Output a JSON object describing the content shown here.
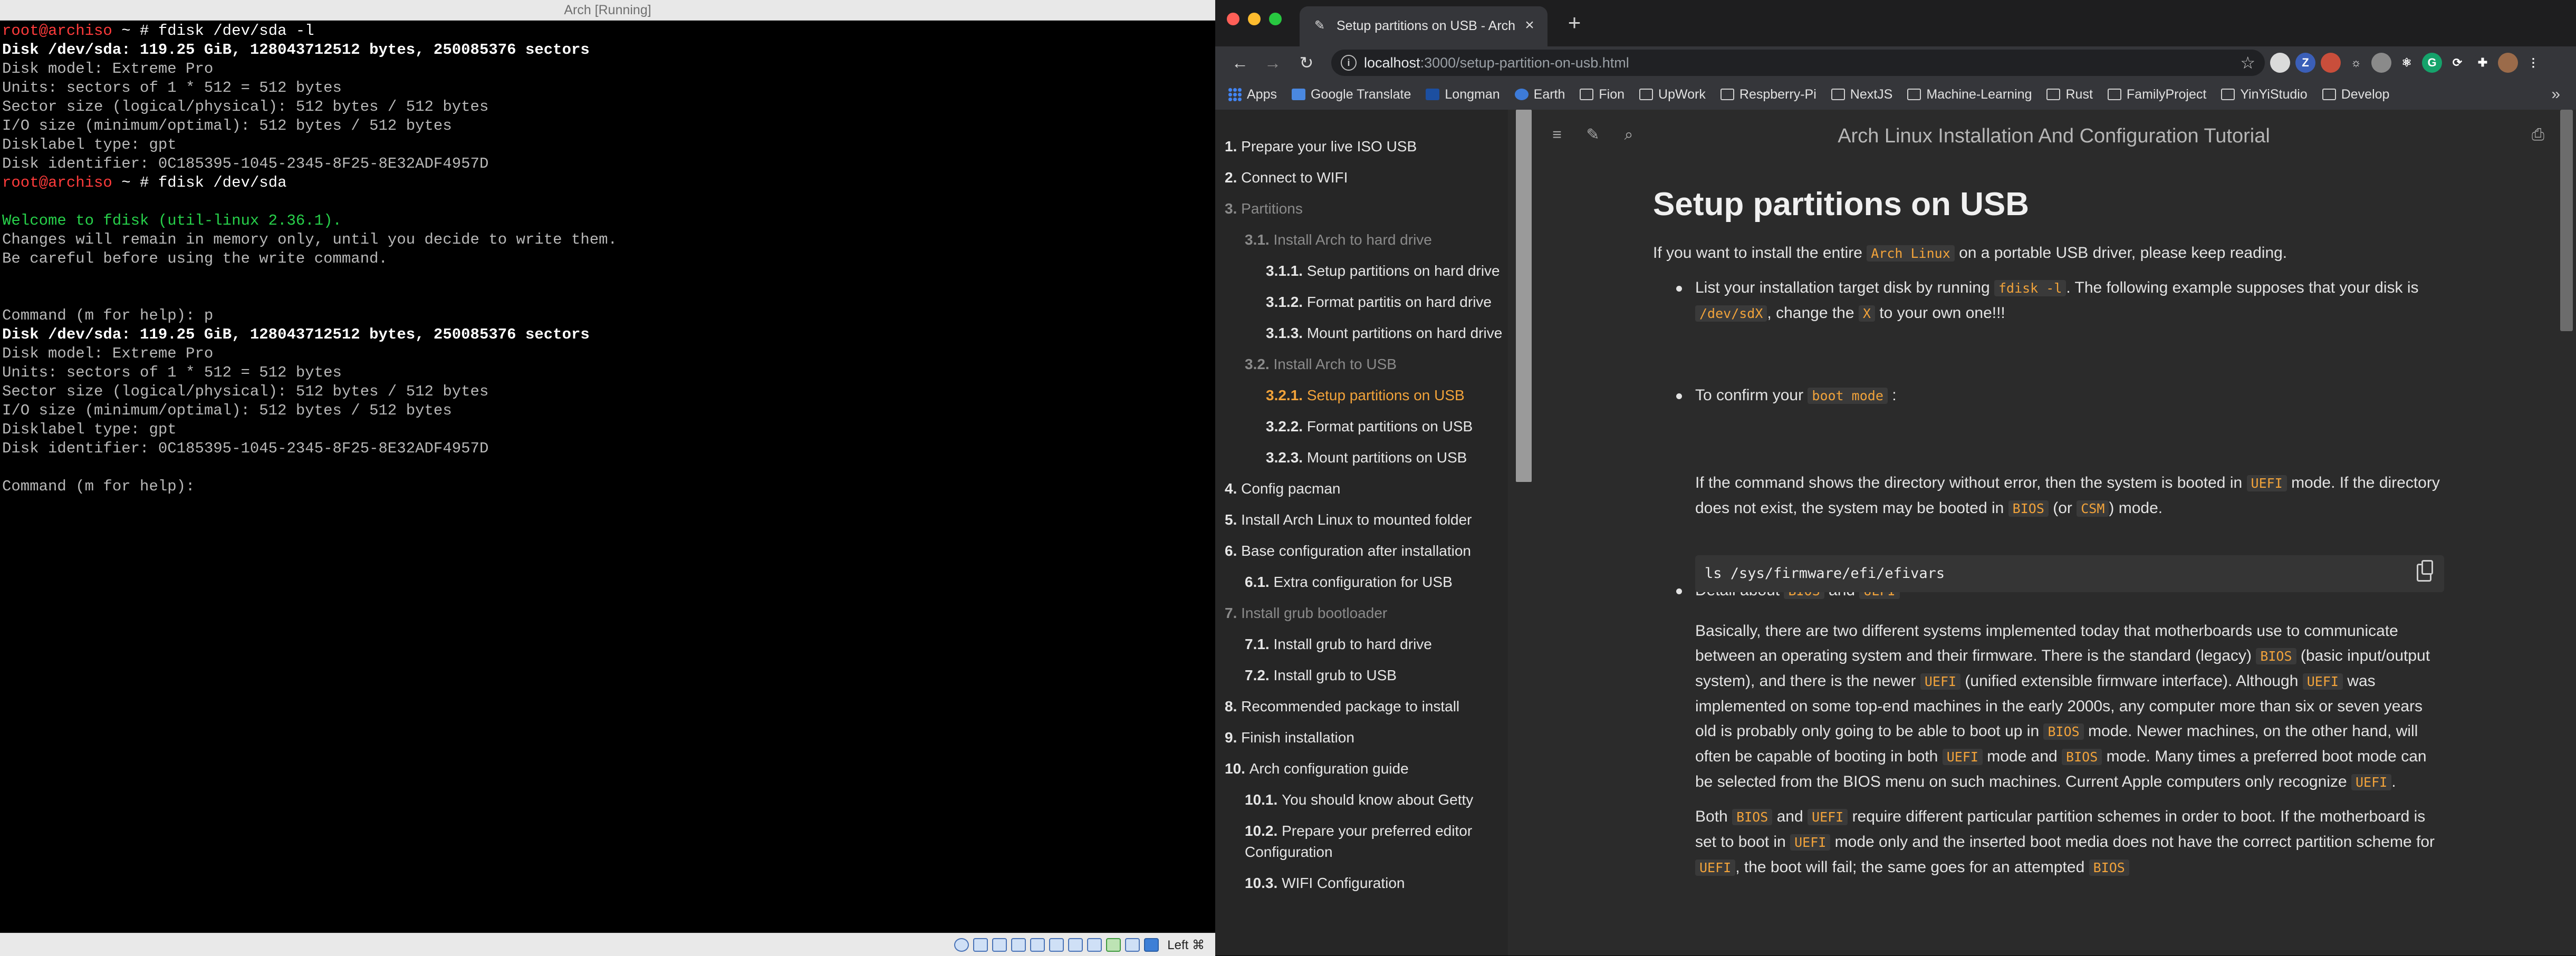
{
  "vm": {
    "title": "Arch [Running]",
    "host_key": "Left ⌘",
    "terminal_lines": [
      {
        "text": "root@archiso ~ # fdisk /dev/sda -l",
        "style": "prompt"
      },
      {
        "text": "Disk /dev/sda: 119.25 GiB, 128043712512 bytes, 250085376 sectors",
        "style": "bold"
      },
      {
        "text": "Disk model: Extreme Pro",
        "style": "normal"
      },
      {
        "text": "Units: sectors of 1 * 512 = 512 bytes",
        "style": "normal"
      },
      {
        "text": "Sector size (logical/physical): 512 bytes / 512 bytes",
        "style": "normal"
      },
      {
        "text": "I/O size (minimum/optimal): 512 bytes / 512 bytes",
        "style": "normal"
      },
      {
        "text": "Disklabel type: gpt",
        "style": "normal"
      },
      {
        "text": "Disk identifier: 0C185395-1045-2345-8F25-8E32ADF4957D",
        "style": "normal"
      },
      {
        "text": "root@archiso ~ # fdisk /dev/sda",
        "style": "prompt"
      },
      {
        "text": "",
        "style": "normal"
      },
      {
        "text": "Welcome to fdisk (util-linux 2.36.1).",
        "style": "green"
      },
      {
        "text": "Changes will remain in memory only, until you decide to write them.",
        "style": "normal"
      },
      {
        "text": "Be careful before using the write command.",
        "style": "normal"
      },
      {
        "text": "",
        "style": "normal"
      },
      {
        "text": "",
        "style": "normal"
      },
      {
        "text": "Command (m for help): p",
        "style": "normal"
      },
      {
        "text": "Disk /dev/sda: 119.25 GiB, 128043712512 bytes, 250085376 sectors",
        "style": "bold"
      },
      {
        "text": "Disk model: Extreme Pro",
        "style": "normal"
      },
      {
        "text": "Units: sectors of 1 * 512 = 512 bytes",
        "style": "normal"
      },
      {
        "text": "Sector size (logical/physical): 512 bytes / 512 bytes",
        "style": "normal"
      },
      {
        "text": "I/O size (minimum/optimal): 512 bytes / 512 bytes",
        "style": "normal"
      },
      {
        "text": "Disklabel type: gpt",
        "style": "normal"
      },
      {
        "text": "Disk identifier: 0C185395-1045-2345-8F25-8E32ADF4957D",
        "style": "normal"
      },
      {
        "text": "",
        "style": "normal"
      },
      {
        "text": "Command (m for help):",
        "style": "normal"
      }
    ],
    "status_icons": [
      "hard-disk-icon",
      "optical-drive-icon",
      "audio-icon",
      "network-icon",
      "usb-icon",
      "shared-folder-icon",
      "display-icon",
      "video-capture-icon",
      "cpu-icon",
      "mouse-integration-icon",
      "arrow-down-icon"
    ]
  },
  "browser": {
    "tab_title": "Setup partitions on USB - Arch Linux",
    "new_tab": "+",
    "url_host": "localhost",
    "url_rest": ":3000/setup-partition-on-usb.html",
    "extension_icons": [
      {
        "name": "profile-badge-icon",
        "glyph": "",
        "color": "#dadada"
      },
      {
        "name": "zotero-icon",
        "glyph": "Z",
        "color": "#3b5fb8"
      },
      {
        "name": "tampermonkey-icon",
        "glyph": "",
        "color": "#c94e3b"
      },
      {
        "name": "sun-icon",
        "glyph": "☼",
        "color": "#35363a"
      },
      {
        "name": "circle-icon",
        "glyph": "",
        "color": "#8a8a8a"
      },
      {
        "name": "react-icon",
        "glyph": "⚛",
        "color": "#35363a"
      },
      {
        "name": "grammarly-icon",
        "glyph": "G",
        "color": "#15a36b"
      },
      {
        "name": "refresh-icon",
        "glyph": "⟳",
        "color": "#35363a"
      },
      {
        "name": "puzzle-icon",
        "glyph": "✚",
        "color": "#35363a"
      },
      {
        "name": "avatar-icon",
        "glyph": "",
        "color": "#9b6b4a"
      },
      {
        "name": "menu-dots-icon",
        "glyph": "⋮",
        "color": "#35363a"
      }
    ],
    "bookmarks": [
      {
        "label": "Apps",
        "icon": "apps"
      },
      {
        "label": "Google Translate",
        "icon": "g"
      },
      {
        "label": "Longman",
        "icon": "ll"
      },
      {
        "label": "Earth",
        "icon": "globe"
      },
      {
        "label": "Fion",
        "icon": "folder"
      },
      {
        "label": "UpWork",
        "icon": "folder"
      },
      {
        "label": "Respberry-Pi",
        "icon": "folder"
      },
      {
        "label": "NextJS",
        "icon": "folder"
      },
      {
        "label": "Machine-Learning",
        "icon": "folder"
      },
      {
        "label": "Rust",
        "icon": "folder"
      },
      {
        "label": "FamilyProject",
        "icon": "folder"
      },
      {
        "label": "YinYiStudio",
        "icon": "folder"
      },
      {
        "label": "Develop",
        "icon": "folder"
      }
    ],
    "bookmarks_more": "»"
  },
  "toc": [
    {
      "num": "1.",
      "label": "Prepare your live ISO USB",
      "level": 1,
      "state": "normal"
    },
    {
      "num": "2.",
      "label": "Connect to WIFI",
      "level": 1,
      "state": "normal"
    },
    {
      "num": "3.",
      "label": "Partitions",
      "level": 1,
      "state": "muted"
    },
    {
      "num": "3.1.",
      "label": "Install Arch to hard drive",
      "level": 2,
      "state": "muted"
    },
    {
      "num": "3.1.1.",
      "label": "Setup partitions on hard drive",
      "level": 3,
      "state": "normal"
    },
    {
      "num": "3.1.2.",
      "label": "Format partitis on hard drive",
      "level": 3,
      "state": "normal"
    },
    {
      "num": "3.1.3.",
      "label": "Mount partitions on hard drive",
      "level": 3,
      "state": "normal"
    },
    {
      "num": "3.2.",
      "label": "Install Arch to USB",
      "level": 2,
      "state": "muted"
    },
    {
      "num": "3.2.1.",
      "label": "Setup partitions on USB",
      "level": 3,
      "state": "active"
    },
    {
      "num": "3.2.2.",
      "label": "Format partitions on USB",
      "level": 3,
      "state": "normal"
    },
    {
      "num": "3.2.3.",
      "label": "Mount partitions on USB",
      "level": 3,
      "state": "normal"
    },
    {
      "num": "4.",
      "label": "Config pacman",
      "level": 1,
      "state": "normal"
    },
    {
      "num": "5.",
      "label": "Install Arch Linux to mounted folder",
      "level": 1,
      "state": "normal"
    },
    {
      "num": "6.",
      "label": "Base configuration after installation",
      "level": 1,
      "state": "normal"
    },
    {
      "num": "6.1.",
      "label": "Extra configuration for USB",
      "level": 2,
      "state": "normal"
    },
    {
      "num": "7.",
      "label": "Install grub bootloader",
      "level": 1,
      "state": "muted"
    },
    {
      "num": "7.1.",
      "label": "Install grub to hard drive",
      "level": 2,
      "state": "normal"
    },
    {
      "num": "7.2.",
      "label": "Install grub to USB",
      "level": 2,
      "state": "normal"
    },
    {
      "num": "8.",
      "label": "Recommended package to install",
      "level": 1,
      "state": "normal"
    },
    {
      "num": "9.",
      "label": "Finish installation",
      "level": 1,
      "state": "normal"
    },
    {
      "num": "10.",
      "label": "Arch configuration guide",
      "level": 1,
      "state": "normal"
    },
    {
      "num": "10.1.",
      "label": "You should know about Getty",
      "level": 2,
      "state": "normal"
    },
    {
      "num": "10.2.",
      "label": "Prepare your preferred editor Configuration",
      "level": 2,
      "state": "normal"
    },
    {
      "num": "10.3.",
      "label": "WIFI Configuration",
      "level": 2,
      "state": "normal"
    }
  ],
  "doc": {
    "site_title": "Arch Linux Installation And Configuration Tutorial",
    "heading": "Setup partitions on USB",
    "intro": [
      "If you want to install the entire ",
      {
        "code": "Arch Linux"
      },
      " on a portable USB driver, please keep reading."
    ],
    "bullet1": [
      "List your installation target disk by running ",
      {
        "code": "fdisk -l"
      },
      ". The following example supposes that your disk is ",
      {
        "code": "/dev/sdX"
      },
      ", change the ",
      {
        "code": "X"
      },
      " to your own one!!!"
    ],
    "bullet2": [
      "To confirm your ",
      {
        "code": "boot mode"
      },
      " :"
    ],
    "codeblock": "ls /sys/firmware/efi/efivars",
    "bullet2_para": [
      "If the command shows the directory without error, then the system is booted in ",
      {
        "code": "UEFI"
      },
      " mode. If the directory does not exist, the system may be booted in ",
      {
        "code": "BIOS"
      },
      " (or ",
      {
        "code": "CSM"
      },
      ") mode."
    ],
    "bullet3": [
      "Detail about ",
      {
        "code": "BIOS"
      },
      " and ",
      {
        "code": "UEFI"
      }
    ],
    "bullet3_para1": [
      "Basically, there are two different systems implemented today that motherboards use to communicate between an operating system and their firmware. There is the standard (legacy) ",
      {
        "code": "BIOS"
      },
      " (basic input/output system), and there is the newer ",
      {
        "code": "UEFI"
      },
      " (unified extensible firmware interface). Although ",
      {
        "code": "UEFI"
      },
      " was implemented on some top-end machines in the early 2000s, any computer more than six or seven years old is probably only going to be able to boot up in ",
      {
        "code": "BIOS"
      },
      " mode. Newer machines, on the other hand, will often be capable of booting in both ",
      {
        "code": "UEFI"
      },
      " mode and ",
      {
        "code": "BIOS"
      },
      " mode. Many times a preferred boot mode can be selected from the BIOS menu on such machines. Current Apple computers only recognize ",
      {
        "code": "UEFI"
      },
      "."
    ],
    "bullet3_para2": [
      "Both ",
      {
        "code": "BIOS"
      },
      " and ",
      {
        "code": "UEFI"
      },
      " require different particular partition schemes in order to boot. If the motherboard is set to boot in ",
      {
        "code": "UEFI"
      },
      " mode only and the inserted boot media does not have the correct partition scheme for ",
      {
        "code": "UEFI"
      },
      ", the boot will fail; the same goes for an attempted ",
      {
        "code": "BIOS"
      }
    ]
  }
}
